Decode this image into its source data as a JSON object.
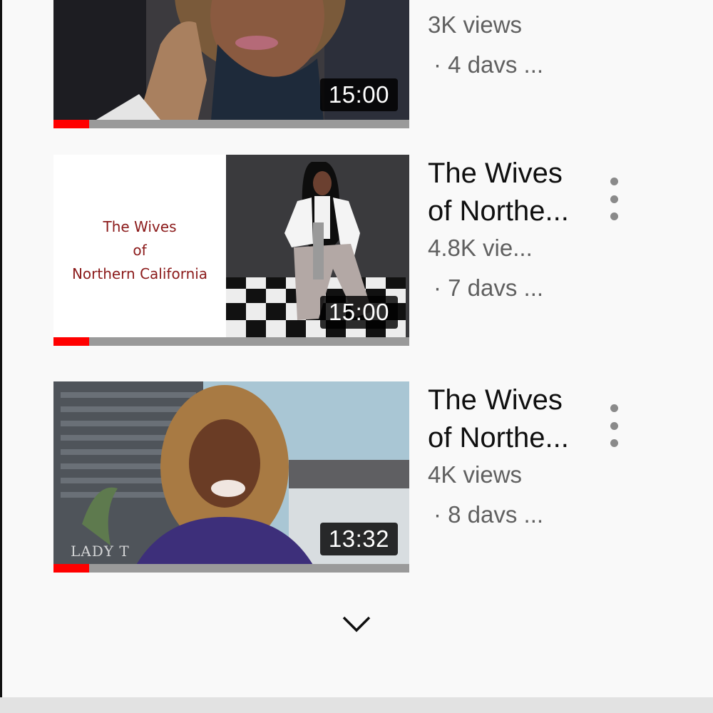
{
  "videos": [
    {
      "title": "",
      "views": "3K views",
      "age": "· 4 davs ...",
      "duration": "15:00",
      "progress": 0.1
    },
    {
      "title": "The Wives of Northe...",
      "views": "4.8K vie...",
      "age": "· 7 davs ...",
      "duration": "15:00",
      "progress": 0.1,
      "thumb_text": [
        "The Wives",
        "of",
        "Northern California"
      ]
    },
    {
      "title": "The Wives of Northe...",
      "views": "4K views",
      "age": "· 8 davs ...",
      "duration": "13:32",
      "progress": 0.1,
      "watermark": "LADY T"
    }
  ],
  "icons": {
    "menu": "more-vert-icon",
    "expand": "chevron-down-icon"
  },
  "colors": {
    "progress": "#ff0000",
    "title_card_text": "#8b1a1a"
  }
}
